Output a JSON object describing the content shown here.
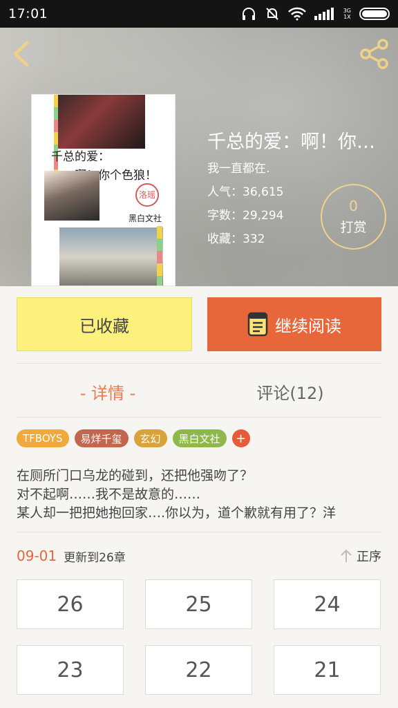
{
  "status_bar": {
    "time": "17:01",
    "network_top": "3G",
    "network_bottom": "1X",
    "icons": [
      "headset-icon",
      "mute-icon",
      "wifi-icon",
      "signal-icon",
      "battery-icon"
    ]
  },
  "header": {
    "back_icon": "chevron-left-icon",
    "share_icon": "share-icon",
    "accent_color": "#f1d187"
  },
  "cover": {
    "title_line1": "千总的爱：",
    "title_line2": "啊！你个色狼！",
    "seal_text": "洛瑶",
    "studio": "黑白文社"
  },
  "book": {
    "title": "千总的爱：啊！你个色狼！",
    "author": "我一直都在.",
    "popularity": "人气：36,615",
    "word_count": "字数：29,294",
    "favorites": "收藏：332",
    "tip_count": "0",
    "tip_label": "打赏"
  },
  "actions": {
    "collected_label": "已收藏",
    "read_label": "继续阅读",
    "collected_color": "#fdf07c",
    "read_color": "#e7673b"
  },
  "tabs": [
    {
      "label": "- 详情 -",
      "active": true
    },
    {
      "label": "评论(12)",
      "active": false
    }
  ],
  "tags": [
    {
      "label": "TFBOYS",
      "color": "#f2a93b"
    },
    {
      "label": "易烊千玺",
      "color": "#c0674d"
    },
    {
      "label": "玄幻",
      "color": "#d9a23a"
    },
    {
      "label": "黑白文社",
      "color": "#8eb94a"
    }
  ],
  "tags_more": "+",
  "description": [
    "在厕所门口乌龙的碰到，还把他强吻了？",
    "对不起啊……我不是故意的……",
    "某人却一把把她抱回家….你以为，道个歉就有用了？洋"
  ],
  "update": {
    "date": "09-01",
    "text": "更新到26章",
    "sort_label": "正序"
  },
  "chapters": [
    "26",
    "25",
    "24",
    "23",
    "22",
    "21"
  ]
}
